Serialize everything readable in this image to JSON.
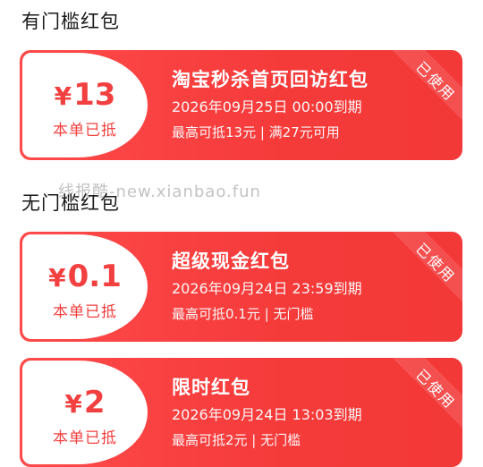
{
  "sections": {
    "threshold": "有门槛红包",
    "no_threshold": "无门槛红包"
  },
  "watermark": "线报酷-new.xianbao.fun",
  "coupons": [
    {
      "currency": "¥",
      "amount": "13",
      "stub_label": "本单已抵",
      "title": "淘宝秒杀首页回访红包",
      "date": "2026年09月25日 00:00到期",
      "rule": "最高可抵13元 | 满27元可用",
      "status": "已使用"
    },
    {
      "currency": "¥",
      "amount": "0.1",
      "stub_label": "本单已抵",
      "title": "超级现金红包",
      "date": "2026年09月24日 23:59到期",
      "rule": "最高可抵0.1元 | 无门槛",
      "status": "已使用"
    },
    {
      "currency": "¥",
      "amount": "2",
      "stub_label": "本单已抵",
      "title": "限时红包",
      "date": "2026年09月24日 13:03到期",
      "rule": "最高可抵2元 | 无门槛",
      "status": "已使用"
    }
  ],
  "colors": {
    "accent": "#f33838",
    "stub_text": "#f24040"
  }
}
